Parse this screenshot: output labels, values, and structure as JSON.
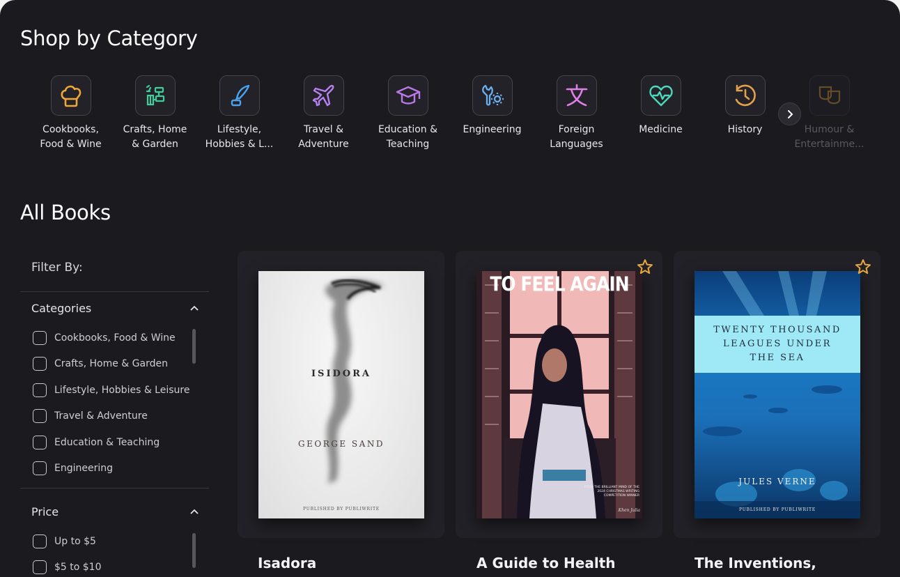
{
  "shop": {
    "title": "Shop by Category",
    "categories": [
      {
        "label": "Cookbooks,\nFood & Wine",
        "icon": "chef-hat-icon",
        "color": "#f0a63a"
      },
      {
        "label": "Crafts, Home\n& Garden",
        "icon": "crafts-icon",
        "color": "#3fcf9c"
      },
      {
        "label": "Lifestyle,\nHobbies & L...",
        "icon": "quill-icon",
        "color": "#4aa3ef"
      },
      {
        "label": "Travel &\nAdventure",
        "icon": "airplane-icon",
        "color": "#b781f0"
      },
      {
        "label": "Education &\nTeaching",
        "icon": "graduation-cap-icon",
        "color": "#b97ae9"
      },
      {
        "label": "Engineering",
        "icon": "gear-wrench-icon",
        "color": "#6ab0ef"
      },
      {
        "label": "Foreign\nLanguages",
        "icon": "translate-icon",
        "color": "#dd7fe6"
      },
      {
        "label": "Medicine",
        "icon": "heartbeat-icon",
        "color": "#4dd9bd"
      },
      {
        "label": "History",
        "icon": "history-clock-icon",
        "color": "#e2a14a"
      },
      {
        "label": "Humour &\nEntertainme...",
        "icon": "theater-masks-icon",
        "color": "#f0a63a"
      }
    ]
  },
  "books": {
    "title": "All Books",
    "filter": {
      "title": "Filter By:",
      "categories_label": "Categories",
      "category_options": [
        "Cookbooks, Food & Wine",
        "Crafts, Home & Garden",
        "Lifestyle, Hobbies & Leisure",
        "Travel & Adventure",
        "Education & Teaching",
        "Engineering"
      ],
      "price_label": "Price",
      "price_options": [
        "Up to $5",
        "$5 to $10"
      ]
    },
    "items": [
      {
        "title": "Isadora",
        "cover_title": "ISIDORA",
        "cover_author": "GEORGE SAND",
        "cover_publisher": "PUBLISHED BY PUBLIWRITE"
      },
      {
        "title": "A Guide to Health",
        "cover_title": "TO FEEL AGAIN",
        "cover_note": "FROM THE BRILLIANT MIND OF THE\n2024 CHRISTMAS WRITING\nCOMPETITION WINNER",
        "cover_signature": "Khen Julia"
      },
      {
        "title": "The Inventions,",
        "cover_title_lines": [
          "TWENTY THOUSAND",
          "LEAGUES UNDER",
          "THE SEA"
        ],
        "cover_author": "JULES VERNE",
        "cover_publisher": "PUBLISHED BY PUBLIWRITE"
      }
    ]
  },
  "colors": {
    "background": "#1b1a1f",
    "card": "#222127",
    "star": "#e9a93c"
  }
}
